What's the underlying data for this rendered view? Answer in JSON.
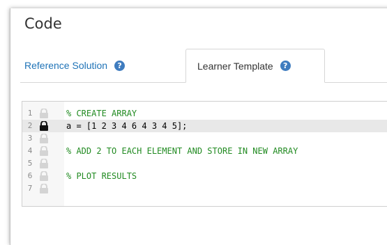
{
  "panel": {
    "title": "Code"
  },
  "tabs": [
    {
      "label": "Reference Solution",
      "help_icon": "?",
      "active": false
    },
    {
      "label": "Learner Template",
      "help_icon": "?",
      "active": true
    }
  ],
  "editor": {
    "lines": [
      {
        "number": "1",
        "text": "% CREATE ARRAY",
        "kind": "comment",
        "locked": false
      },
      {
        "number": "2",
        "text": "a = [1 2 3 4 6 4 3 4 5];",
        "kind": "statement",
        "locked": true
      },
      {
        "number": "3",
        "text": "",
        "kind": "blank",
        "locked": false
      },
      {
        "number": "4",
        "text": "% ADD 2 TO EACH ELEMENT AND STORE IN NEW ARRAY",
        "kind": "comment",
        "locked": false
      },
      {
        "number": "5",
        "text": "",
        "kind": "blank",
        "locked": false
      },
      {
        "number": "6",
        "text": "% PLOT RESULTS",
        "kind": "comment",
        "locked": false
      },
      {
        "number": "7",
        "text": "",
        "kind": "blank",
        "locked": false
      }
    ]
  },
  "colors": {
    "link_blue": "#1f73b7",
    "help_blue": "#3f7cbf",
    "comment_green": "#228b22",
    "highlight": "#e8e8e8"
  }
}
